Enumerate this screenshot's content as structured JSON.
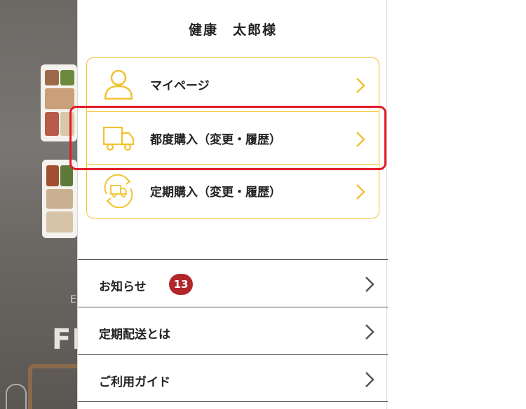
{
  "user": {
    "name": "健康　太郎様"
  },
  "account_menu": {
    "items": [
      {
        "label": "マイページ",
        "icon": "person-icon"
      },
      {
        "label": "都度購入（変更・履歴）",
        "icon": "delivery-truck-icon"
      },
      {
        "label": "定期購入（変更・履歴）",
        "icon": "recurring-delivery-icon"
      }
    ]
  },
  "nav_list": {
    "items": [
      {
        "label": "お知らせ",
        "badge": "13"
      },
      {
        "label": "定期配送とは"
      },
      {
        "label": "ご利用ガイド"
      }
    ]
  },
  "background": {
    "text": "FI",
    "small_text": "E"
  },
  "colors": {
    "accent": "#f2c230",
    "highlight": "#e21b2a",
    "badge": "#b0262b",
    "chevron": "#555555"
  }
}
